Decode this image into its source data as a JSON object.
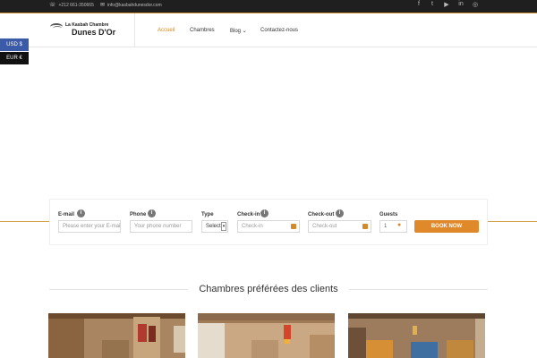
{
  "topbar": {
    "phone": "+212 661-350665",
    "email": "info@kasbahdunesdor.com",
    "phone_icon": "phone-icon",
    "email_icon": "envelope-icon",
    "social": [
      "facebook-icon",
      "twitter-icon",
      "youtube-icon",
      "linkedin-icon",
      "instagram-icon"
    ],
    "social_glyphs": [
      "f",
      "t",
      "▶",
      "in",
      "◎"
    ]
  },
  "logo": {
    "small": "La Kasbah Chambre",
    "big": "Dunes D'Or"
  },
  "nav": [
    {
      "label": "Accueil",
      "active": true
    },
    {
      "label": "Chambres"
    },
    {
      "label": "Blog ⌄"
    },
    {
      "label": "Contactez-nous"
    }
  ],
  "currency": [
    {
      "label": "USD $",
      "color": "#3b5aa8"
    },
    {
      "label": "EUR €",
      "color": "#111111"
    }
  ],
  "booking": {
    "email_label": "E-mail",
    "email_placeholder": "Please enter your E-mail",
    "phone_label": "Phone",
    "phone_placeholder": "Your phone number",
    "type_label": "Type",
    "type_value": "Select",
    "checkin_label": "Check-in",
    "checkin_placeholder": "Check-in",
    "checkout_label": "Check-out",
    "checkout_placeholder": "Check-out",
    "guests_label": "Guests",
    "guests_value": "1",
    "info_glyph": "i",
    "button": "BOOK NOW"
  },
  "section": {
    "title": "Chambres préférées des clients"
  },
  "colors": {
    "accent": "#e0892b",
    "topbar": "#1f1f1f",
    "usd": "#3b5aa8"
  }
}
